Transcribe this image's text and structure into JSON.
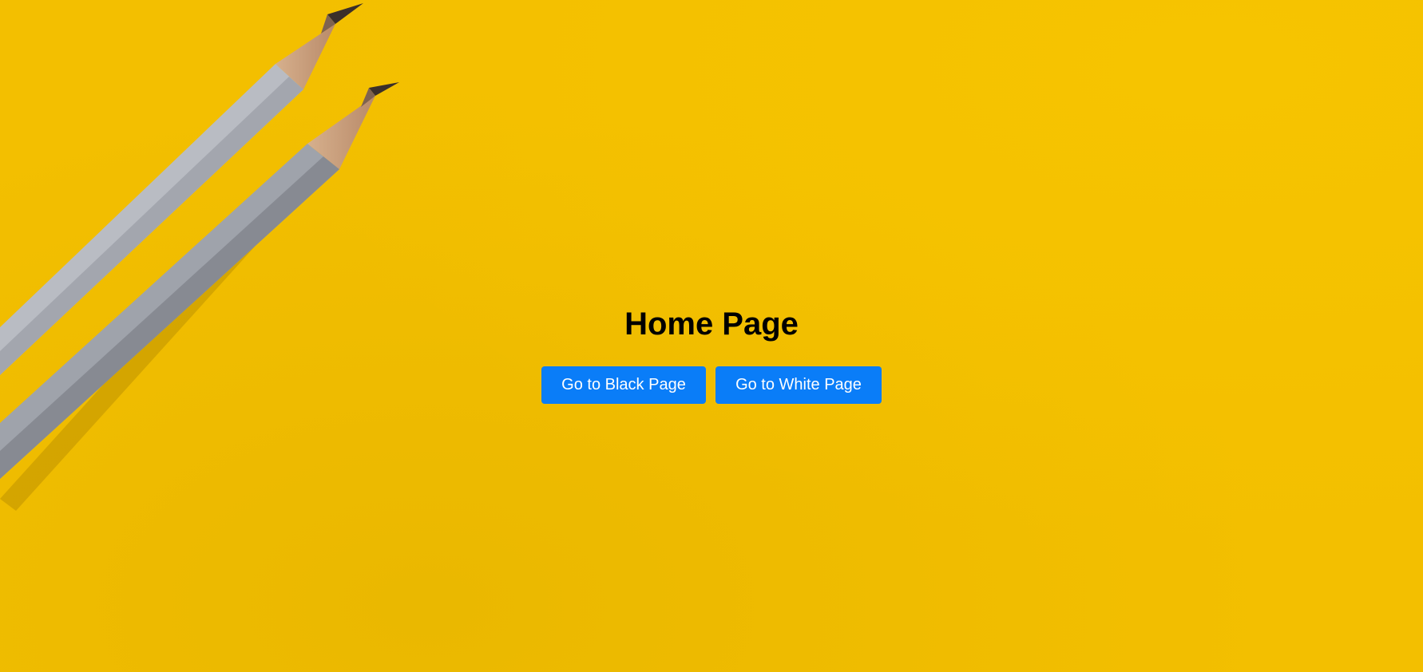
{
  "page": {
    "title": "Home Page",
    "background_color": "#f3bf00"
  },
  "buttons": {
    "black_page_label": "Go to Black Page",
    "white_page_label": "Go to White Page",
    "color": "#0a7df8"
  },
  "decor": {
    "image_icon": "pencils-image"
  }
}
